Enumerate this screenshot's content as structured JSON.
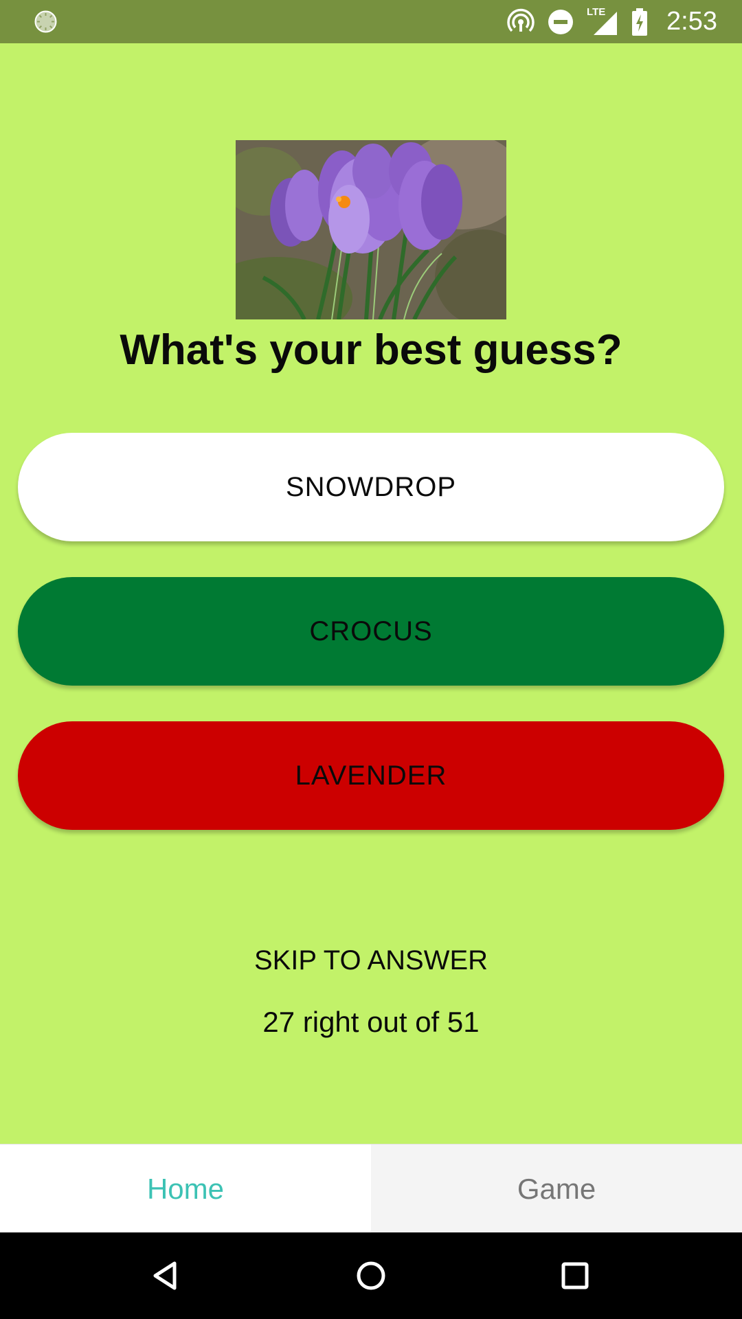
{
  "status_bar": {
    "time": "2:53",
    "network_label": "LTE",
    "icons": [
      "sync-icon",
      "hotspot-icon",
      "do-not-disturb-icon",
      "lte-signal-icon",
      "battery-charging-icon"
    ],
    "background_color": "#77913f"
  },
  "quiz": {
    "image": "crocus-flower-photo",
    "question": "What's your best guess?",
    "options": [
      {
        "label": "SNOWDROP",
        "state": "default",
        "color": "#ffffff"
      },
      {
        "label": "CROCUS",
        "state": "correct",
        "color": "#007a33"
      },
      {
        "label": "LAVENDER",
        "state": "wrong",
        "color": "#cc0000"
      }
    ],
    "skip_label": "SKIP TO ANSWER",
    "score_text": "27 right out of 51",
    "background_color": "#c2f269"
  },
  "tabs": [
    {
      "label": "Home",
      "active": true,
      "color": "#3cc2b4"
    },
    {
      "label": "Game",
      "active": false,
      "color": "#767676"
    }
  ],
  "nav": {
    "icons": [
      "back-icon",
      "home-icon",
      "recents-icon"
    ]
  }
}
